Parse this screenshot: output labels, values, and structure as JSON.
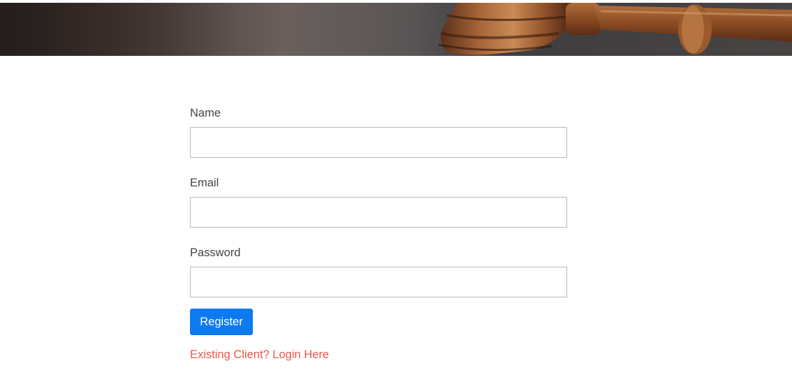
{
  "form": {
    "name_label": "Name",
    "email_label": "Email",
    "password_label": "Password",
    "name_value": "",
    "email_value": "",
    "password_value": "",
    "register_label": "Register",
    "login_link_label": "Existing Client? Login Here"
  },
  "colors": {
    "button_bg": "#0d7af0",
    "button_text": "#ffffff",
    "link": "#e8584a",
    "label_text": "#444444",
    "input_border": "#b9b9b9"
  },
  "hero": {
    "image_subject": "gavel-image"
  }
}
